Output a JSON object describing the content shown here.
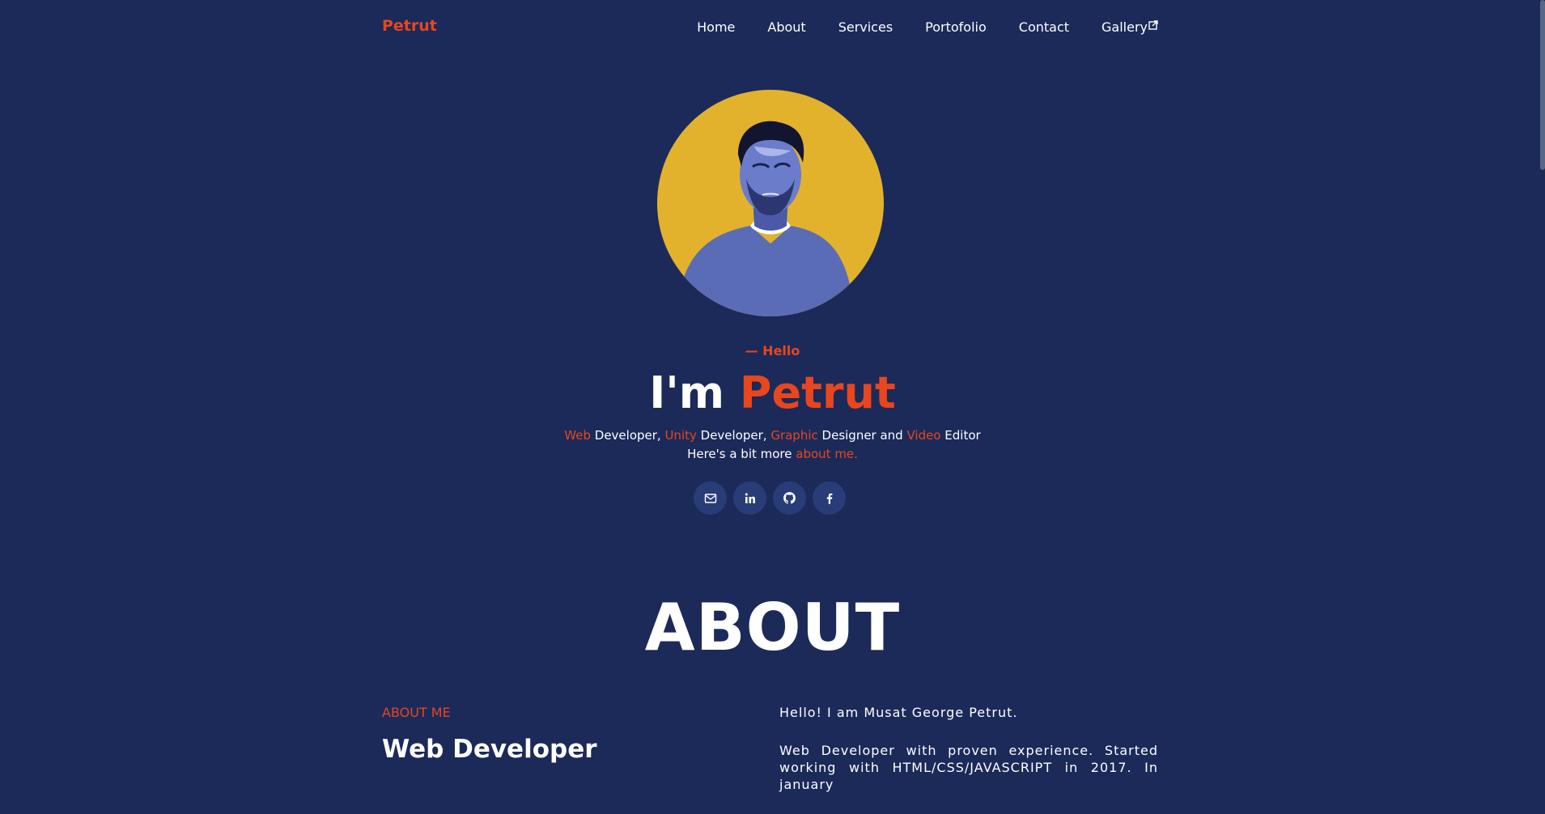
{
  "brand": {
    "logo": "Petrut"
  },
  "nav": {
    "items": [
      {
        "label": "Home"
      },
      {
        "label": "About"
      },
      {
        "label": "Services"
      },
      {
        "label": "Portofolio"
      },
      {
        "label": "Contact"
      },
      {
        "label": "Gallery"
      }
    ]
  },
  "hero": {
    "hello": "— Hello",
    "title_prefix": "I'm ",
    "title_name": "Petrut",
    "roles": {
      "r1": "Web",
      "t1": " Developer, ",
      "r2": "Unity",
      "t2": " Developer, ",
      "r3": "Graphic",
      "t3": " Designer and ",
      "r4": "Video",
      "t4": " Editor"
    },
    "more_text": "Here's a bit more ",
    "more_link": "about me."
  },
  "socials": [
    {
      "icon": "mail-icon"
    },
    {
      "icon": "linkedin-icon"
    },
    {
      "icon": "github-icon"
    },
    {
      "icon": "facebook-icon"
    }
  ],
  "about": {
    "heading": "ABOUT",
    "label": "ABOUT ME",
    "role": "Web Developer",
    "p1": "Hello! I am Musat George Petrut.",
    "p2": "Web Developer with proven experience. Started working with HTML/CSS/JAVASCRIPT in 2017. In january"
  },
  "colors": {
    "background": "#1b2a59",
    "accent": "#e8461e",
    "avatar_bg": "#e2b22c",
    "social_bg": "#283c78"
  }
}
